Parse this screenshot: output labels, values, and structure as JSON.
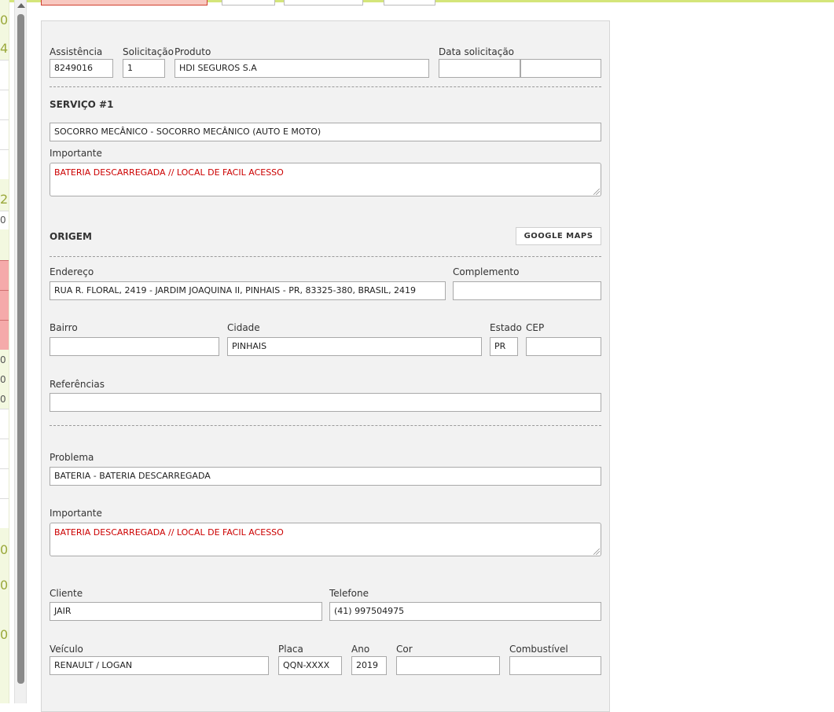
{
  "left_strip": {
    "numbers": [
      "0",
      "4",
      "2",
      "0",
      "0",
      "0"
    ],
    "small_values": [
      "0",
      "0",
      "0",
      "0"
    ]
  },
  "form": {
    "assistencia": {
      "label": "Assistência",
      "value": "8249016"
    },
    "solicitacao": {
      "label": "Solicitação",
      "value": "1"
    },
    "produto": {
      "label": "Produto",
      "value": "HDI SEGUROS S.A"
    },
    "data_solicitacao": {
      "label": "Data solicitação",
      "date": "",
      "time": ""
    },
    "servico_title": "SERVIÇO #1",
    "servico_value": "SOCORRO MECÂNICO - SOCORRO MECÂNICO (AUTO E MOTO)",
    "importante1": {
      "label": "Importante",
      "value": "BATERIA DESCARREGADA // LOCAL DE FACIL ACESSO"
    },
    "origem_title": "ORIGEM",
    "google_maps_label": "GOOGLE MAPS",
    "endereco": {
      "label": "Endereço",
      "value": "RUA R. FLORAL, 2419 - JARDIM JOAQUINA II, PINHAIS - PR, 83325-380, BRASIL, 2419"
    },
    "complemento": {
      "label": "Complemento",
      "value": ""
    },
    "bairro": {
      "label": "Bairro",
      "value": ""
    },
    "cidade": {
      "label": "Cidade",
      "value": "PINHAIS"
    },
    "estado": {
      "label": "Estado",
      "value": "PR"
    },
    "cep": {
      "label": "CEP",
      "value": ""
    },
    "referencias": {
      "label": "Referências",
      "value": ""
    },
    "problema": {
      "label": "Problema",
      "value": "BATERIA - BATERIA DESCARREGADA"
    },
    "importante2": {
      "label": "Importante",
      "value": "BATERIA DESCARREGADA // LOCAL DE FACIL ACESSO"
    },
    "cliente": {
      "label": "Cliente",
      "value": "JAIR"
    },
    "telefone": {
      "label": "Telefone",
      "value": "(41) 997504975"
    },
    "veiculo": {
      "label": "Veículo",
      "value": "RENAULT / LOGAN"
    },
    "placa": {
      "label": "Placa",
      "value": "QQN-XXXX"
    },
    "ano": {
      "label": "Ano",
      "value": "2019"
    },
    "cor": {
      "label": "Cor",
      "value": ""
    },
    "combustivel": {
      "label": "Combustível",
      "value": ""
    }
  }
}
